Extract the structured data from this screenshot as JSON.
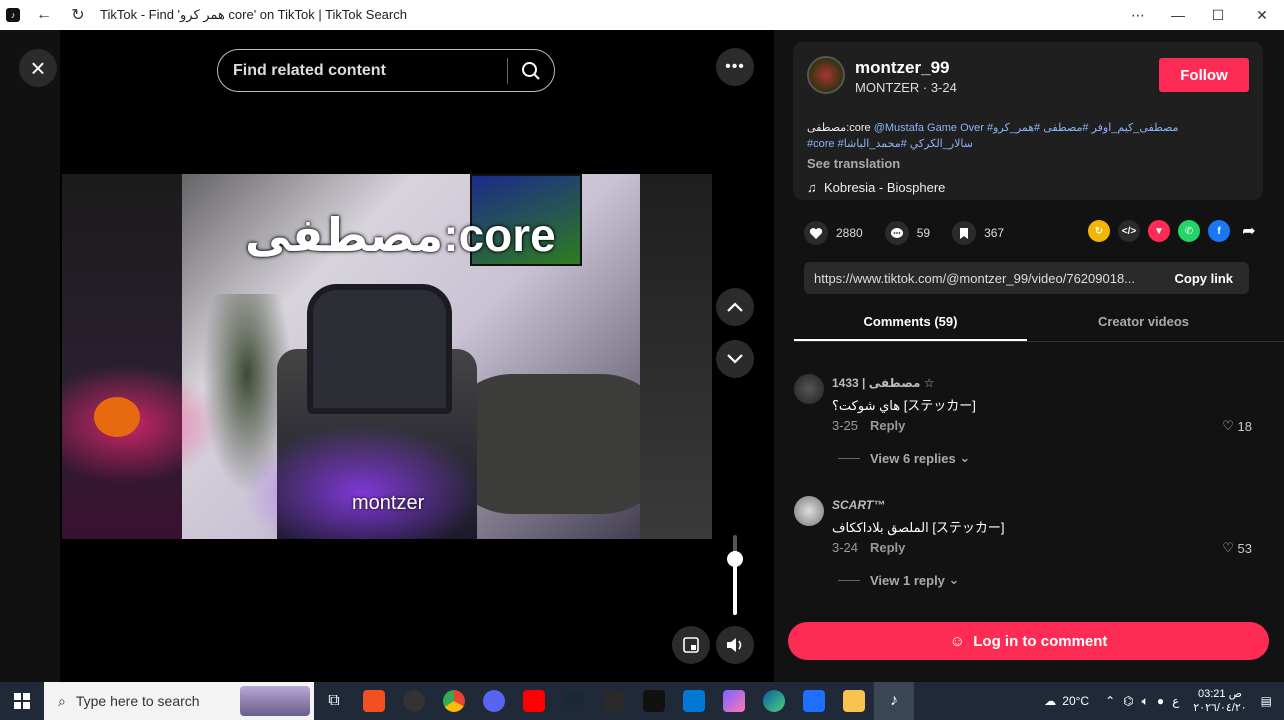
{
  "window": {
    "title": "TikTok - Find 'همر كرو core' on TikTok | TikTok Search",
    "app_icon": "tiktok-icon",
    "controls": {
      "more": "⋯",
      "minimize": "—",
      "maximize": "☐",
      "close": "✕"
    }
  },
  "player": {
    "search_placeholder": "Find related content",
    "caption_top": "مصطفى:core",
    "caption_bottom": "montzer",
    "volume_level_percent": 70
  },
  "post": {
    "username": "montzer_99",
    "subtitle": "MONTZER · 3-24",
    "follow_label": "Follow",
    "description_line1_prefix": "مصطفى:core ",
    "description_line1_tags": "@Mustafa Game Over #مصطفى_كيم_اوفر #مصطفى #همر_كرو",
    "description_line2_tags": "#core #سالار_الكركي #محمد_الباشا",
    "see_translation": "See translation",
    "music": "Kobresia - Biosphere",
    "likes": "2880",
    "comments_count": "59",
    "saves": "367",
    "share_colors": {
      "repost": "#f2b705",
      "embed": "#2b2b2b",
      "dm": "#fe2c55",
      "whatsapp": "#25d366",
      "facebook": "#1877f2"
    },
    "link_url": "https://www.tiktok.com/@montzer_99/video/76209018...",
    "copy_link_label": "Copy link"
  },
  "tabs": [
    {
      "label": "Comments (59)",
      "active": true
    },
    {
      "label": "Creator videos",
      "active": false
    }
  ],
  "comments": [
    {
      "name": "مصطفى | 1433 ☆",
      "text": "هاي شوكت؟ [ステッカー]",
      "date": "3-25",
      "reply_label": "Reply",
      "likes": "18",
      "view_replies": "View 6 replies"
    },
    {
      "name": "SCART™",
      "text": "الملصق بلاداككاف [ステッカー]",
      "date": "3-24",
      "reply_label": "Reply",
      "likes": "53",
      "view_replies": "View 1 reply"
    }
  ],
  "login_label": "Log in to comment",
  "taskbar": {
    "search_placeholder": "Type here to search",
    "weather": "20°C",
    "time": "03:21 ص",
    "date": "٢٠٢٦/٠٤/٢٠",
    "lang": "ع"
  }
}
